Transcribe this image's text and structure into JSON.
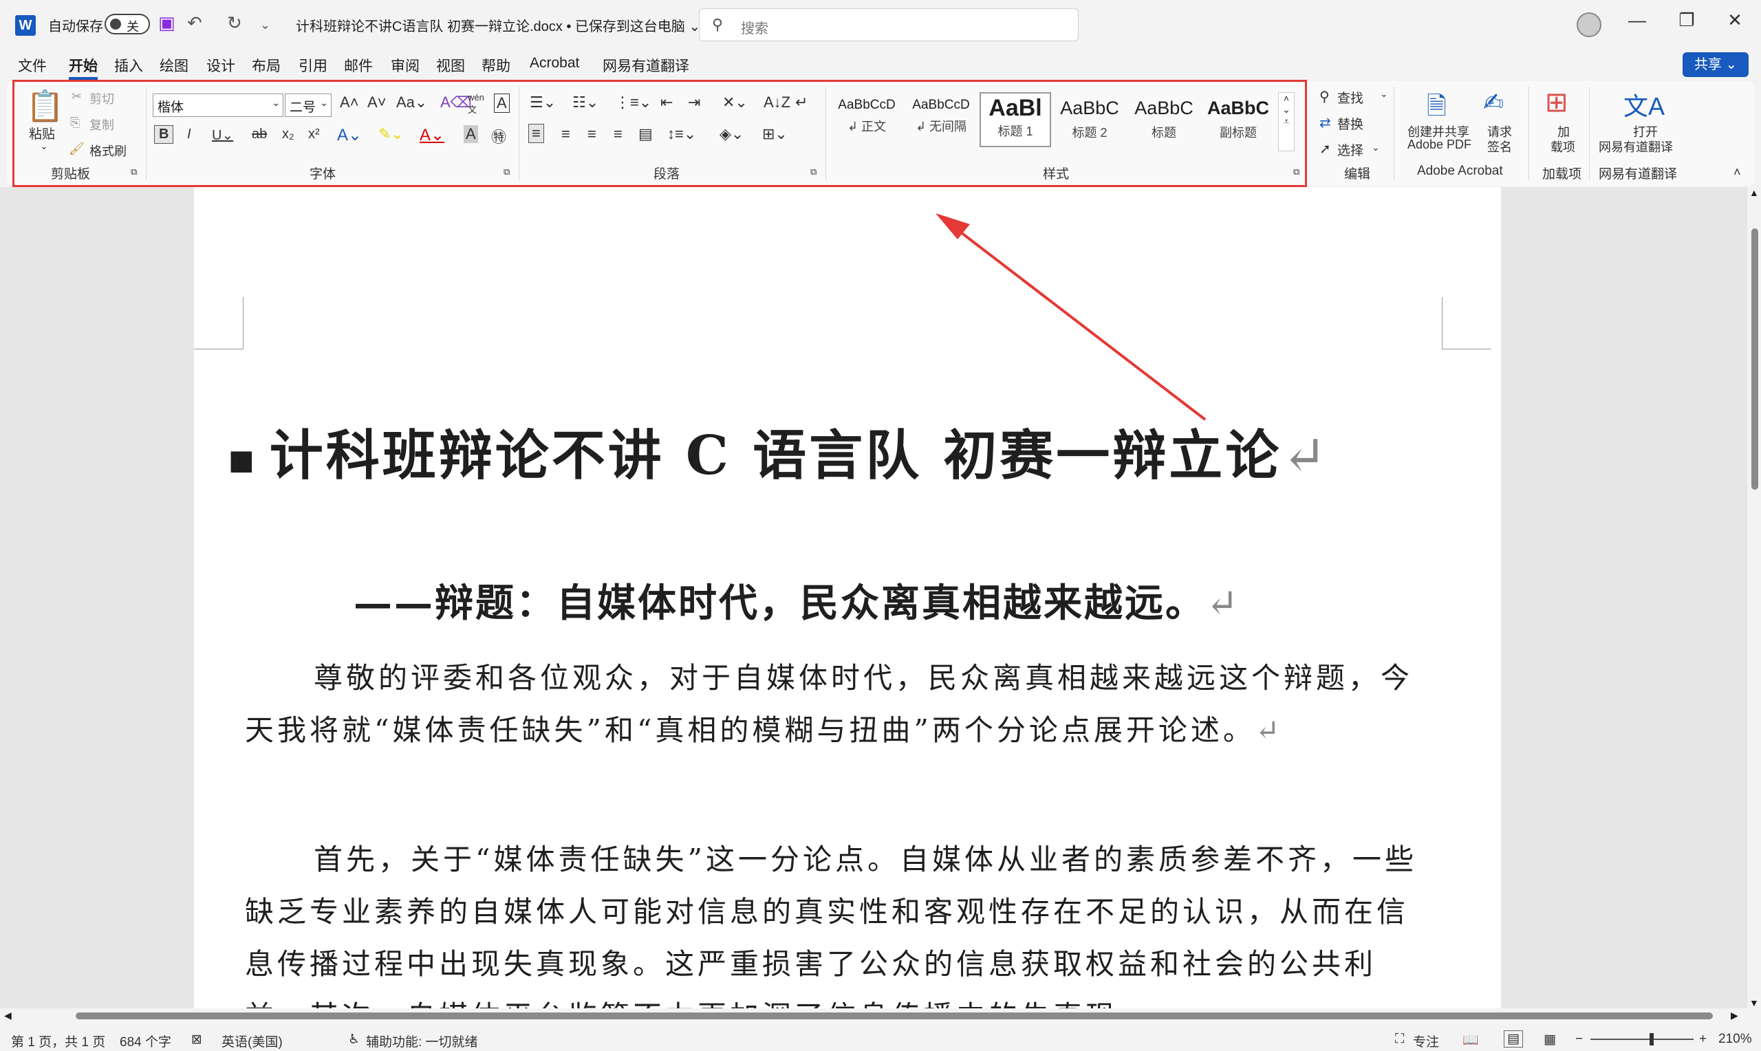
{
  "titlebar": {
    "autosave_label": "自动保存",
    "autosave_state": "关",
    "doc_title": "计科班辩论不讲C语言队 初赛一辩立论.docx • 已保存到这台电脑 ⌄",
    "search_placeholder": "搜索"
  },
  "tabs": [
    "文件",
    "开始",
    "插入",
    "绘图",
    "设计",
    "布局",
    "引用",
    "邮件",
    "审阅",
    "视图",
    "帮助",
    "Acrobat",
    "网易有道翻译"
  ],
  "share_label": "共享 ⌄",
  "ribbon": {
    "clipboard": {
      "paste": "粘贴",
      "cut": "剪切",
      "copy": "复制",
      "format_painter": "格式刷",
      "label": "剪贴板"
    },
    "font": {
      "font_name": "楷体",
      "font_size": "二号",
      "label": "字体"
    },
    "paragraph": {
      "label": "段落"
    },
    "styles": {
      "label": "样式",
      "items": [
        {
          "preview": "AaBbCcD",
          "name": "↲ 正文"
        },
        {
          "preview": "AaBbCcD",
          "name": "↲ 无间隔"
        },
        {
          "preview": "AaBl",
          "name": "标题 1"
        },
        {
          "preview": "AaBbC",
          "name": "标题 2"
        },
        {
          "preview": "AaBbC",
          "name": "标题"
        },
        {
          "preview": "AaBbC",
          "name": "副标题"
        }
      ]
    },
    "editing": {
      "find": "查找",
      "replace": "替换",
      "select": "选择",
      "label": "编辑"
    },
    "acrobat": {
      "create_share": "创建并共享",
      "create_share2": "Adobe PDF",
      "request": "请求",
      "request2": "签名",
      "label": "Adobe Acrobat"
    },
    "addins": {
      "btn": "加",
      "btn2": "载项",
      "label": "加载项"
    },
    "youdao": {
      "btn": "打开",
      "btn2": "网易有道翻译",
      "label": "网易有道翻译"
    }
  },
  "document": {
    "title": "计科班辩论不讲 C 语言队 初赛一辩立论",
    "subtitle": "——辩题：自媒体时代，民众离真相越来越远。",
    "paragraphs": [
      "尊敬的评委和各位观众，对于自媒体时代，民众离真相越来越远这个辩题，今天我将就“媒体责任缺失”和“真相的模糊与扭曲”两个分论点展开论述。",
      "首先，关于“媒体责任缺失”这一分论点。自媒体从业者的素质参差不齐，一些缺乏专业素养的自媒体人可能对信息的真实性和客观性存在不足的认识，从而在信息传播过程中出现失真现象。这严重损害了公众的信息获取权益和社会的公共利益。其次，自媒体平台监管不力更加深了信息传播中的失真现"
    ]
  },
  "statusbar": {
    "page": "第 1 页，共 1 页",
    "words": "684 个字",
    "language": "英语(美国)",
    "accessibility": "辅助功能: 一切就绪",
    "focus": "专注",
    "zoom": "210%"
  }
}
